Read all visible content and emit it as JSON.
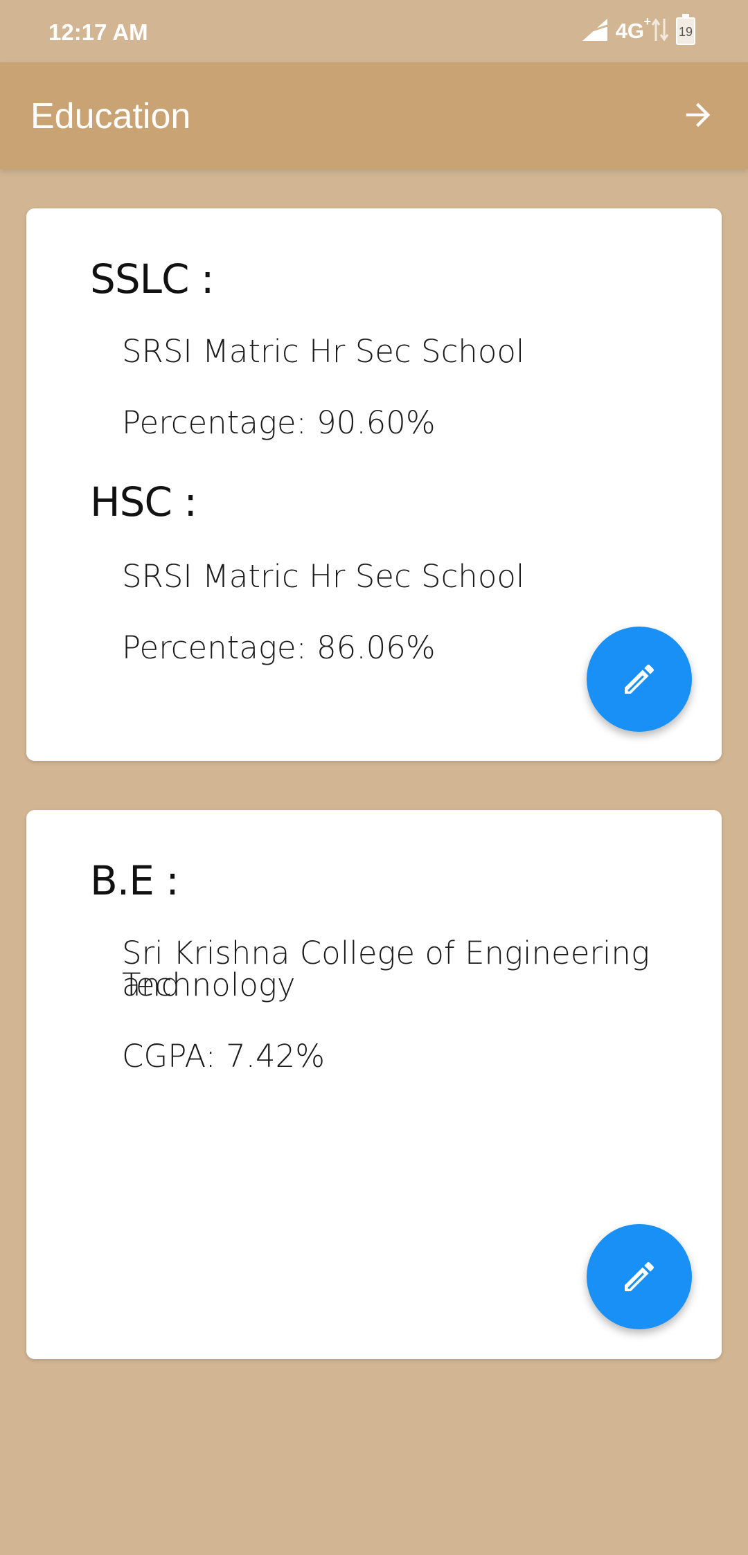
{
  "status_bar": {
    "time": "12:17 AM",
    "network": "4G",
    "network_sup": "+",
    "battery_level": "19",
    "icons": [
      "signal-icon",
      "data-arrows-icon",
      "battery-icon"
    ]
  },
  "app_bar": {
    "title": "Education",
    "action_icon": "arrow-forward-icon",
    "background": "#c9a373"
  },
  "cards": [
    {
      "sections": [
        {
          "heading": "SSLC :",
          "school": "SRSI Matric Hr Sec School",
          "score": "Percentage: 90.60%"
        },
        {
          "heading": "HSC :",
          "school": "SRSI Matric Hr Sec School",
          "score": "Percentage: 86.06%"
        }
      ],
      "fab_icon": "edit-pencil-icon"
    },
    {
      "sections": [
        {
          "heading": "B.E :",
          "school_line1": "Sri Krishna College of Engineering and",
          "school_line2": "Technology",
          "score": "CGPA: 7.42%"
        }
      ],
      "fab_icon": "edit-pencil-icon"
    }
  ],
  "colors": {
    "page_background": "#d2b693",
    "fab": "#1890f5",
    "card": "#ffffff"
  }
}
